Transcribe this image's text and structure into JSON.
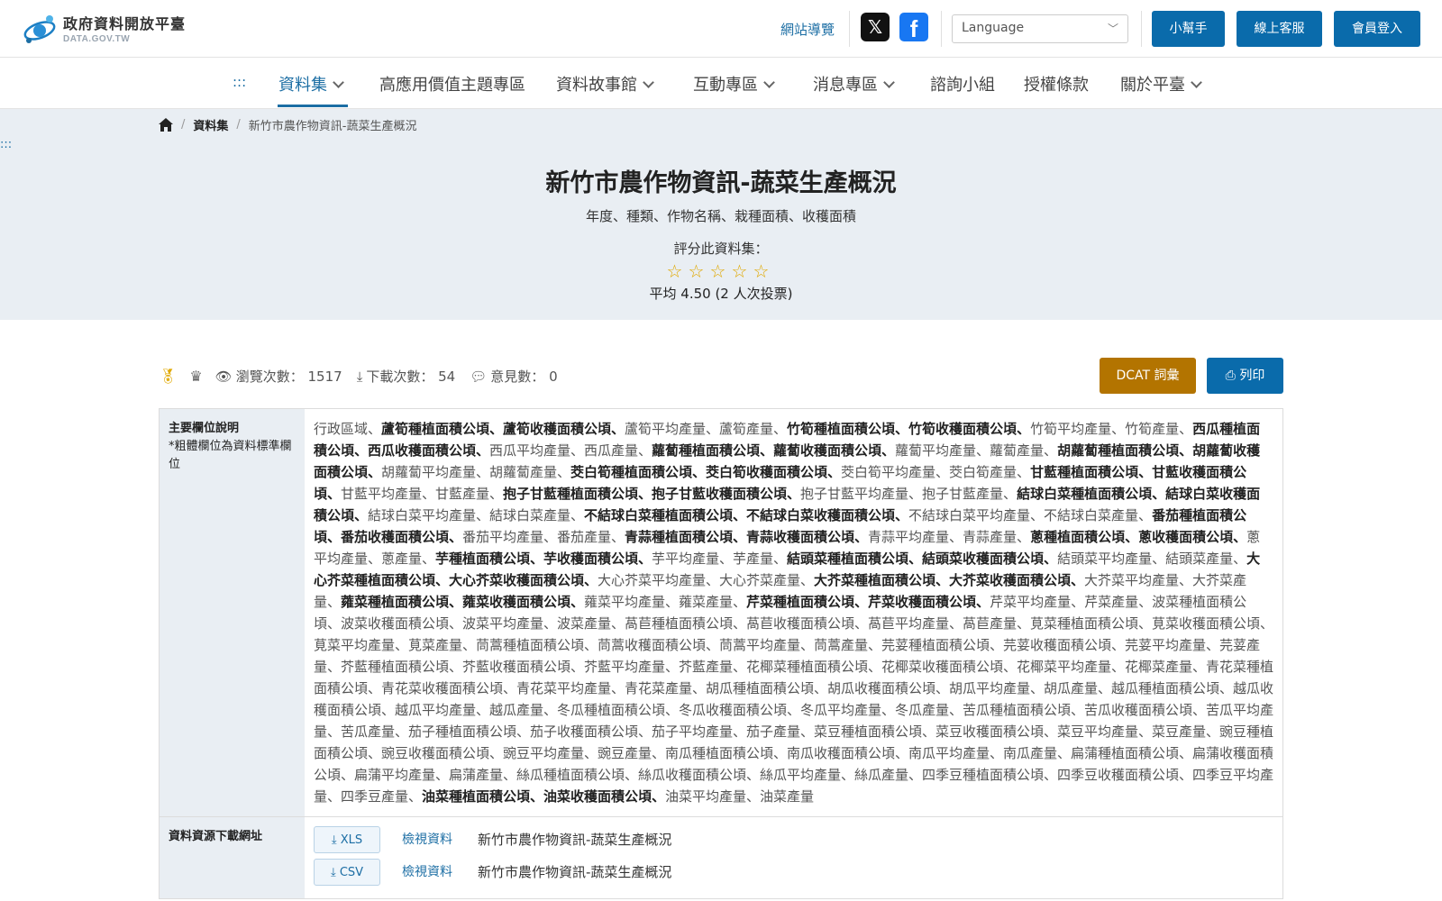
{
  "header": {
    "logo_title": "政府資料開放平臺",
    "logo_sub": "DATA.GOV.TW",
    "sitemap": "網站導覽",
    "x_icon": "x-logo-icon",
    "fb_icon": "facebook-icon",
    "language": "Language",
    "buttons": [
      "小幫手",
      "線上客服",
      "會員登入"
    ],
    "accent": "#0a6bab"
  },
  "nav": {
    "skip": ":::",
    "items": [
      "資料集",
      "高應用價值主題專區",
      "資料故事館",
      "互動專區",
      "消息專區",
      "諮詢小組",
      "授權條款",
      "關於平臺"
    ]
  },
  "breadcrumb": [
    "資料集",
    "新竹市農作物資訊-蔬菜生產概況"
  ],
  "side_skip": ":::",
  "dataset": {
    "title": "新竹市農作物資訊-蔬菜生產概況",
    "subtitle": "年度、種類、作物名稱、栽種面積、收穫面積",
    "rate_label": "評分此資料集：",
    "rating": 0,
    "average": "平均 4.50 (2 人次投票)"
  },
  "stats": {
    "views_label": "瀏覽次數：",
    "views": "1517",
    "downloads_label": "下載次數：",
    "downloads": "54",
    "comments_label": "意見數：",
    "comments": "0"
  },
  "actions": {
    "dcat": "DCAT 詞彙",
    "print": "列印"
  },
  "table": {
    "fields_head": "主要欄位說明",
    "fields_note": "*粗體欄位為資料標準欄位",
    "fields": [
      {
        "t": "行政區域、",
        "b": false
      },
      {
        "t": "蘆筍種植面積公頃、蘆筍收穫面積公頃、",
        "b": true
      },
      {
        "t": "蘆筍平均產量、蘆筍產量、",
        "b": false
      },
      {
        "t": "竹筍種植面積公頃、竹筍收穫面積公頃、",
        "b": true
      },
      {
        "t": "竹筍平均產量、竹筍產量、",
        "b": false
      },
      {
        "t": "西瓜種植面積公頃、西瓜收穫面積公頃、",
        "b": true
      },
      {
        "t": "西瓜平均產量、西瓜產量、",
        "b": false
      },
      {
        "t": "蘿蔔種植面積公頃、蘿蔔收穫面積公頃、",
        "b": true
      },
      {
        "t": "蘿蔔平均產量、蘿蔔產量、",
        "b": false
      },
      {
        "t": "胡蘿蔔種植面積公頃、胡蘿蔔收穫面積公頃、",
        "b": true
      },
      {
        "t": "胡蘿蔔平均產量、胡蘿蔔產量、",
        "b": false
      },
      {
        "t": "茭白筍種植面積公頃、茭白筍收穫面積公頃、",
        "b": true
      },
      {
        "t": "茭白筍平均產量、茭白筍產量、",
        "b": false
      },
      {
        "t": "甘藍種植面積公頃、甘藍收穫面積公頃、",
        "b": true
      },
      {
        "t": "甘藍平均產量、甘藍產量、",
        "b": false
      },
      {
        "t": "抱子甘藍種植面積公頃、抱子甘藍收穫面積公頃、",
        "b": true
      },
      {
        "t": "抱子甘藍平均產量、抱子甘藍產量、",
        "b": false
      },
      {
        "t": "結球白菜種植面積公頃、結球白菜收穫面積公頃、",
        "b": true
      },
      {
        "t": "結球白菜平均產量、結球白菜產量、",
        "b": false
      },
      {
        "t": "不結球白菜種植面積公頃、不結球白菜收穫面積公頃、",
        "b": true
      },
      {
        "t": "不結球白菜平均產量、不結球白菜產量、",
        "b": false
      },
      {
        "t": "番茄種植面積公頃、番茄收穫面積公頃、",
        "b": true
      },
      {
        "t": "番茄平均產量、番茄產量、",
        "b": false
      },
      {
        "t": "青蒜種植面積公頃、青蒜收穫面積公頃、",
        "b": true
      },
      {
        "t": "青蒜平均產量、青蒜產量、",
        "b": false
      },
      {
        "t": "蔥種植面積公頃、蔥收穫面積公頃、",
        "b": true
      },
      {
        "t": "蔥平均產量、蔥產量、",
        "b": false
      },
      {
        "t": "芋種植面積公頃、芋收穫面積公頃、",
        "b": true
      },
      {
        "t": "芋平均產量、芋產量、",
        "b": false
      },
      {
        "t": "結頭菜種植面積公頃、結頭菜收穫面積公頃、",
        "b": true
      },
      {
        "t": "結頭菜平均產量、結頭菜產量、",
        "b": false
      },
      {
        "t": "大心芥菜種植面積公頃、大心芥菜收穫面積公頃、",
        "b": true
      },
      {
        "t": "大心芥菜平均產量、大心芥菜產量、",
        "b": false
      },
      {
        "t": "大芥菜種植面積公頃、大芥菜收穫面積公頃、",
        "b": true
      },
      {
        "t": "大芥菜平均產量、大芥菜產量、",
        "b": false
      },
      {
        "t": "蕹菜種植面積公頃、蕹菜收穫面積公頃、",
        "b": true
      },
      {
        "t": "蕹菜平均產量、蕹菜產量、",
        "b": false
      },
      {
        "t": "芹菜種植面積公頃、芹菜收穫面積公頃、",
        "b": true
      },
      {
        "t": "芹菜平均產量、芹菜產量、波菜種植面積公頃、波菜收穫面積公頃、波菜平均產量、波菜產量、萵苣種植面積公頃、萵苣收穫面積公頃、萵苣平均產量、萵苣產量、莧菜種植面積公頃、莧菜收穫面積公頃、莧菜平均產量、莧菜產量、茼蒿種植面積公頃、茼蒿收穫面積公頃、茼蒿平均產量、茼蒿產量、芫荽種植面積公頃、芫荽收穫面積公頃、芫荽平均產量、芫荽產量、芥藍種植面積公頃、芥藍收穫面積公頃、芥藍平均產量、芥藍產量、花椰菜種植面積公頃、花椰菜收穫面積公頃、花椰菜平均產量、花椰菜產量、青花菜種植面積公頃、青花菜收穫面積公頃、青花菜平均產量、青花菜產量、胡瓜種植面積公頃、胡瓜收穫面積公頃、胡瓜平均產量、胡瓜產量、越瓜種植面積公頃、越瓜收穫面積公頃、越瓜平均產量、越瓜產量、冬瓜種植面積公頃、冬瓜收穫面積公頃、冬瓜平均產量、冬瓜產量、苦瓜種植面積公頃、苦瓜收穫面積公頃、苦瓜平均產量、苦瓜產量、茄子種植面積公頃、茄子收穫面積公頃、茄子平均產量、茄子產量、菜豆種植面積公頃、菜豆收穫面積公頃、菜豆平均產量、菜豆產量、豌豆種植面積公頃、豌豆收穫面積公頃、豌豆平均產量、豌豆產量、南瓜種植面積公頃、南瓜收穫面積公頃、南瓜平均產量、南瓜產量、扁蒲種植面積公頃、扁蒲收穫面積公頃、扁蒲平均產量、扁蒲產量、絲瓜種植面積公頃、絲瓜收穫面積公頃、絲瓜平均產量、絲瓜產量、四季豆種植面積公頃、四季豆收穫面積公頃、四季豆平均產量、四季豆產量、",
        "b": false
      },
      {
        "t": "油菜種植面積公頃、油菜收穫面積公頃、",
        "b": true
      },
      {
        "t": "油菜平均產量、油菜產量",
        "b": false
      }
    ],
    "download_head": "資料資源下載網址",
    "downloads": [
      {
        "format": "XLS",
        "view": "檢視資料",
        "name": "新竹市農作物資訊-蔬菜生產概況"
      },
      {
        "format": "CSV",
        "view": "檢視資料",
        "name": "新竹市農作物資訊-蔬菜生產概況"
      }
    ]
  }
}
